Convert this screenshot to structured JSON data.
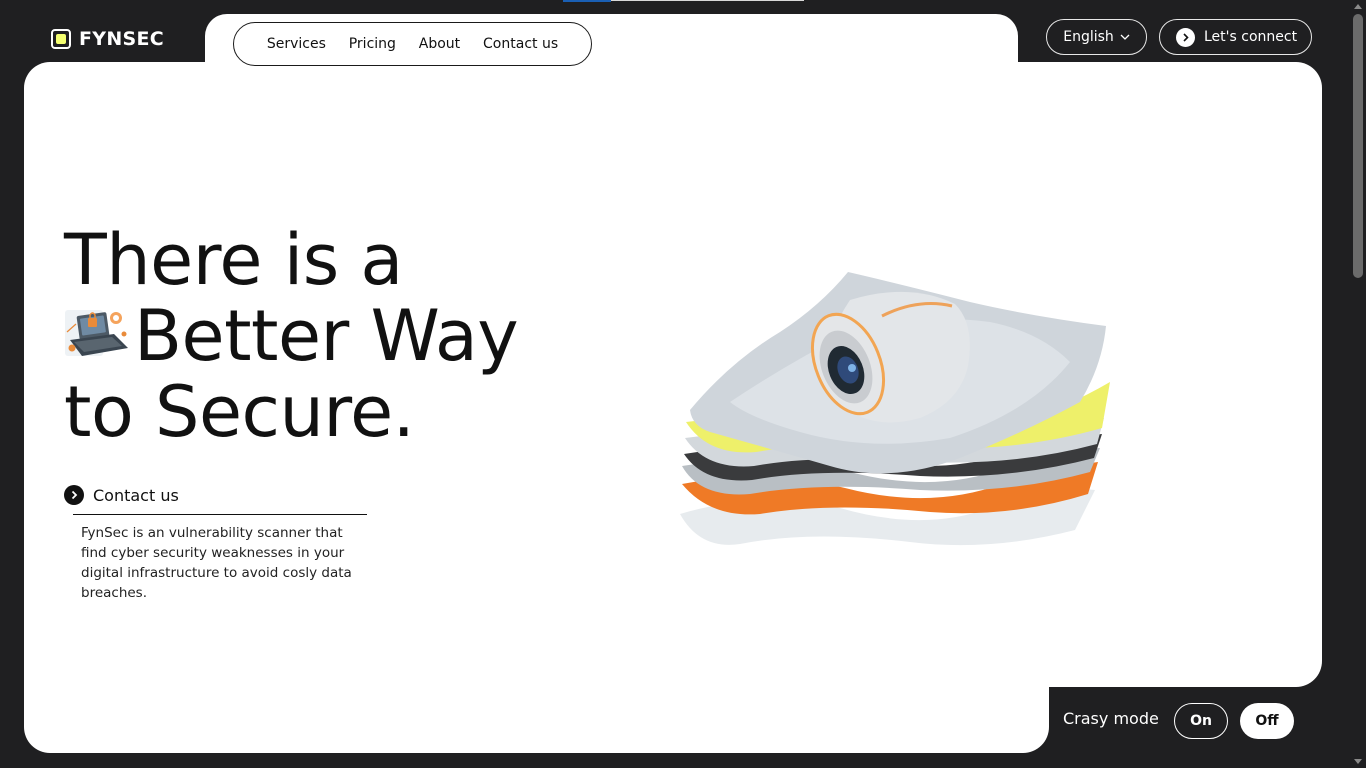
{
  "brand": {
    "name": "FYNSEC",
    "accent_color": "#f4ff70"
  },
  "nav": {
    "items": [
      "Services",
      "Pricing",
      "About",
      "Contact us"
    ]
  },
  "header": {
    "language": "English",
    "connect_label": "Let's connect"
  },
  "hero": {
    "line1": "There is a",
    "line2": "Better Way",
    "line3": "to Secure.",
    "inline_icon": "laptop-security-icon"
  },
  "contact_link": "Contact us",
  "description": "FynSec is an vulnerability scanner that find cyber security weaknesses in your digital infrastructure to avoid cosly data breaches.",
  "crasy_mode": {
    "label": "Crasy mode",
    "on": "On",
    "off": "Off",
    "selected": "Off"
  },
  "colors": {
    "background": "#1f1f21",
    "card": "#ffffff",
    "text": "#111111"
  }
}
